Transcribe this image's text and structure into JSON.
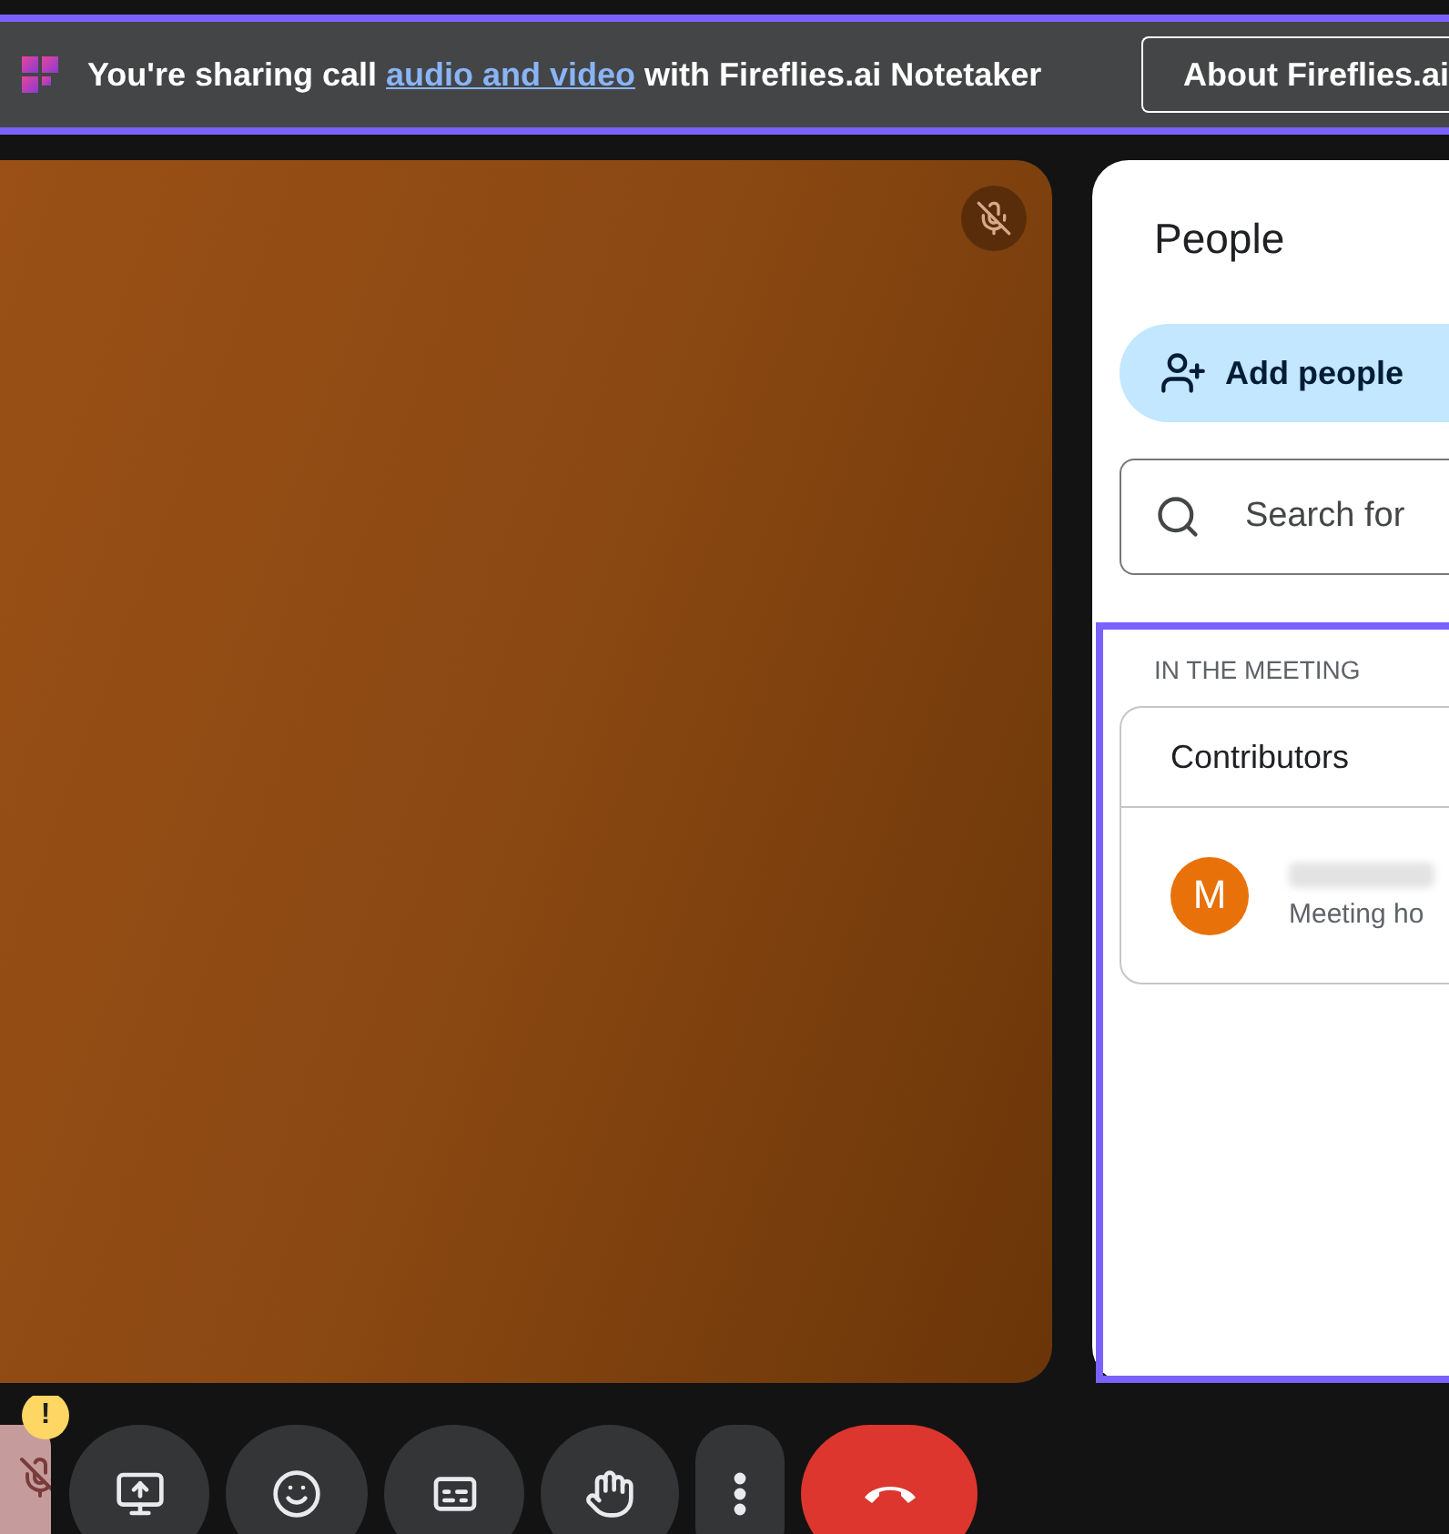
{
  "banner": {
    "link": "audio and video",
    "text_before": "You're sharing call",
    "text_after": "with Fireflies.ai Notetaker",
    "button": "About Fireflies.ai"
  },
  "video_tile": {
    "muted": true
  },
  "people_panel": {
    "title": "People",
    "add_button": "Add people",
    "search": {
      "placeholder": "Search for"
    },
    "section_label": "IN THE MEETING",
    "group_title": "Contributors",
    "participants": [
      {
        "initial": "M",
        "role": "Meeting ho",
        "color": "#e8710a"
      }
    ]
  },
  "controls": [
    {
      "kind": "mic",
      "muted": true,
      "warning": "!"
    },
    {
      "kind": "present"
    },
    {
      "kind": "emoji"
    },
    {
      "kind": "captions"
    },
    {
      "kind": "hand"
    },
    {
      "kind": "more"
    },
    {
      "kind": "end"
    }
  ]
}
